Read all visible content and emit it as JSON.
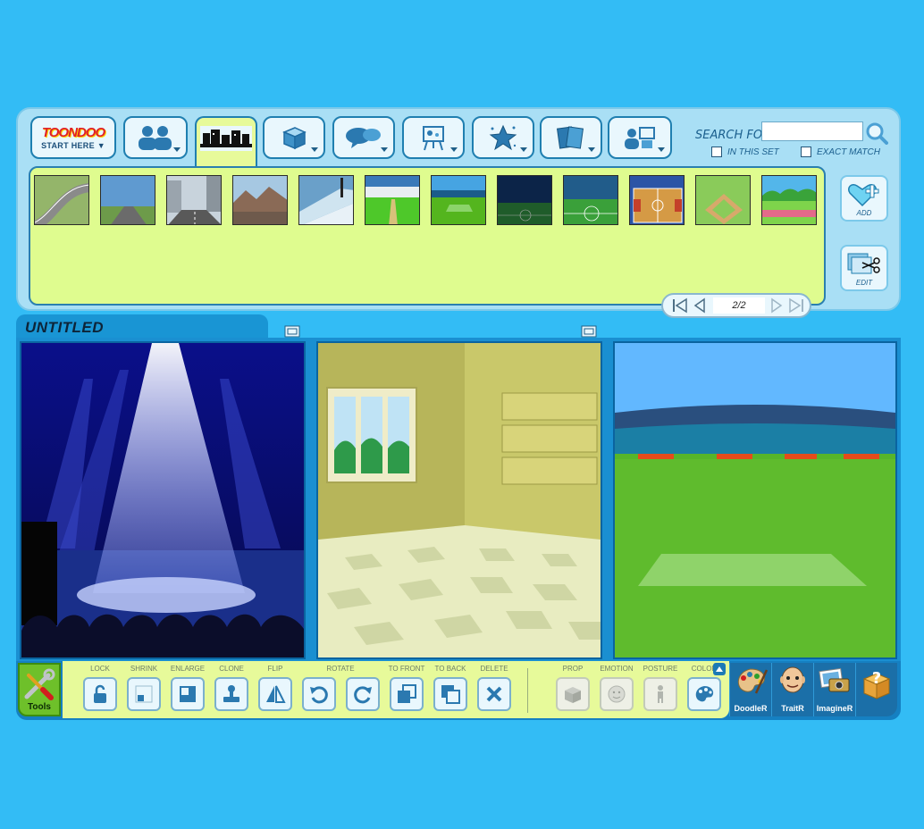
{
  "nav": {
    "logo_text": "TOON",
    "logo_text2": "DOO",
    "start_label": "START HERE",
    "tabs": [
      {
        "name": "characters",
        "icon": "characters-icon"
      },
      {
        "name": "backgrounds",
        "icon": "backgrounds-icon"
      },
      {
        "name": "props",
        "icon": "props-icon"
      },
      {
        "name": "speech-bubbles",
        "icon": "speech-bubble-icon"
      },
      {
        "name": "my-images",
        "icon": "easel-icon"
      },
      {
        "name": "favorites",
        "icon": "star-icon"
      },
      {
        "name": "templates",
        "icon": "cards-icon"
      },
      {
        "name": "community",
        "icon": "user-gallery-icon"
      }
    ]
  },
  "search": {
    "label": "SEARCH FOR",
    "value": "",
    "in_this_set_label": "IN THIS SET",
    "exact_match_label": "EXACT MATCH"
  },
  "library": {
    "items": [
      {
        "name": "highway-curve",
        "sky": "#9fc1d6",
        "ground": "#6f8a4a"
      },
      {
        "name": "country-road",
        "sky": "#6aa4d3",
        "ground": "#6e9b4a"
      },
      {
        "name": "city-street",
        "sky": "#c9d3dc",
        "ground": "#5c5c5c"
      },
      {
        "name": "desert-mountains",
        "sky": "#9fc4df",
        "ground": "#8a6a56"
      },
      {
        "name": "ski-slope",
        "sky": "#6aa0c9",
        "ground": "#e8f1f7"
      },
      {
        "name": "cricket-field",
        "sky": "#3a79b9",
        "ground": "#4ec82a"
      },
      {
        "name": "soccer-field-day",
        "sky": "#46a4e2",
        "ground": "#54b51e"
      },
      {
        "name": "soccer-field-night",
        "sky": "#0c2448",
        "ground": "#1f5c2a"
      },
      {
        "name": "soccer-field-dusk",
        "sky": "#215c8a",
        "ground": "#3aa03a"
      },
      {
        "name": "basketball-court",
        "sky": "#2b55a6",
        "ground": "#d59a45"
      },
      {
        "name": "baseball-diamond",
        "sky": "#8acb5a",
        "ground": "#d7a96b"
      },
      {
        "name": "park-field",
        "sky": "#53b6ea",
        "ground": "#7ed44b"
      }
    ],
    "add_label": "ADD",
    "edit_label": "EDIT",
    "page": "2/2"
  },
  "comic": {
    "title": "UNTITLED"
  },
  "toolbar": {
    "tools_label": "Tools",
    "tools": [
      {
        "label": "LOCK",
        "icon": "lock-icon",
        "enabled": true
      },
      {
        "label": "SHRINK",
        "icon": "shrink-icon",
        "enabled": true
      },
      {
        "label": "ENLARGE",
        "icon": "enlarge-icon",
        "enabled": true
      },
      {
        "label": "CLONE",
        "icon": "clone-icon",
        "enabled": true
      },
      {
        "label": "FLIP",
        "icon": "flip-icon",
        "enabled": true
      },
      {
        "label": "ROTATE",
        "icon": "rotate-icon",
        "enabled": true
      },
      {
        "label": "TO FRONT",
        "icon": "to-front-icon",
        "enabled": true
      },
      {
        "label": "TO BACK",
        "icon": "to-back-icon",
        "enabled": true
      },
      {
        "label": "DELETE",
        "icon": "delete-icon",
        "enabled": true
      },
      {
        "label": "PROP",
        "icon": "prop-icon",
        "enabled": false
      },
      {
        "label": "EMOTION",
        "icon": "emotion-icon",
        "enabled": false
      },
      {
        "label": "POSTURE",
        "icon": "posture-icon",
        "enabled": false
      },
      {
        "label": "COLOR",
        "icon": "palette-icon",
        "enabled": true
      }
    ],
    "right_tools": [
      {
        "label": "DoodleR",
        "icon": "paint-palette-icon"
      },
      {
        "label": "TraitR",
        "icon": "face-icon"
      },
      {
        "label": "ImagineR",
        "icon": "camera-icon"
      },
      {
        "label": "",
        "icon": "help-box-icon"
      }
    ]
  }
}
